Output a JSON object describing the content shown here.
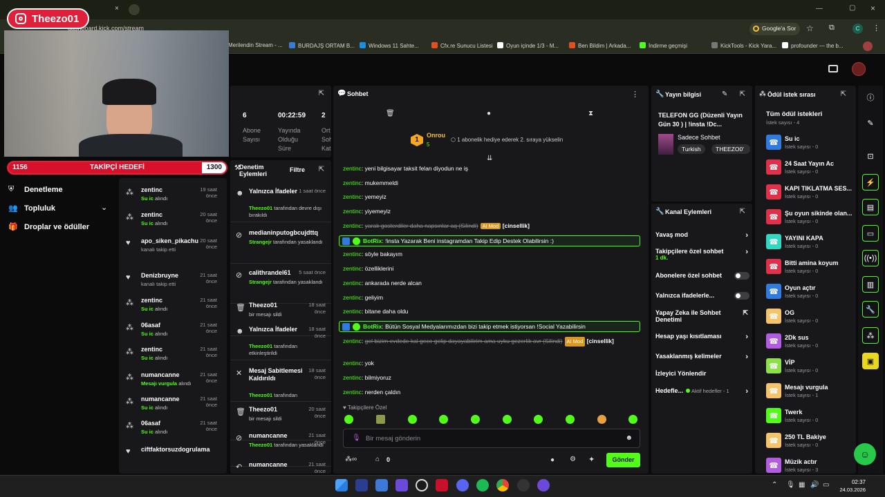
{
  "browser": {
    "url": "dashboard.kick.com/stream",
    "google_search": "Google'a Sor",
    "profile": "C",
    "bookmarks": [
      {
        "label": "Merilendin Stream - ...",
        "color": "#e04040"
      },
      {
        "label": "BURDAJŞ ORTAM B...",
        "color": "#3a7bd5"
      },
      {
        "label": "Windows 11 Sahte...",
        "color": "#1a8fe0"
      },
      {
        "label": "Cfx.re Sunucu Listesi",
        "color": "#e05020"
      },
      {
        "label": "Oyun içinde 1/3 - M...",
        "color": "#ffffff"
      },
      {
        "label": "Ben Bildim | Arkada...",
        "color": "#e05020"
      },
      {
        "label": "İndirme geçmişi",
        "color": "#53fc18"
      },
      {
        "label": "KickTools - Kick Yara...",
        "color": "#777777"
      },
      {
        "label": "profounder — the b...",
        "color": "#ffffff"
      }
    ]
  },
  "overlay": {
    "instagram_name": "Theezo01",
    "goal_current": "1156",
    "goal_label": "TAKİPÇİ HEDEFİ",
    "goal_target": "1300",
    "goal_progress": 0.889
  },
  "left_nav": {
    "items": [
      {
        "label": "Denetleme",
        "icon": "shield-icon"
      },
      {
        "label": "Topluluk",
        "icon": "users-icon"
      },
      {
        "label": "Droplar ve ödüller",
        "icon": "gift-icon"
      }
    ]
  },
  "stats": {
    "items": [
      {
        "value": "6",
        "label": "Abone Sayısı"
      },
      {
        "value": "00:22:59",
        "label": "Yayında Olduğu Süre"
      },
      {
        "value": "2",
        "label": "Ort. Sohbet Katılımcısı"
      }
    ],
    "label_lines": [
      [
        "Abone",
        "Sayısı"
      ],
      [
        "Yayında",
        "Olduğu",
        "Süre"
      ],
      [
        "Ort",
        "Soh",
        "Kat"
      ]
    ]
  },
  "activity": {
    "events": [
      {
        "name": "zentinc",
        "time": "19 saat önce",
        "sub": "Su ic alındı",
        "icon": "cheer-icon"
      },
      {
        "name": "zentinc",
        "time": "20 saat önce",
        "sub": "Su ic alındı",
        "icon": "cheer-icon"
      },
      {
        "name": "apo_siken_pikachu",
        "time": "20 saat önce",
        "sub": "kanalı takip etti",
        "icon": "heart-icon"
      },
      {
        "name": "Denizbruyne",
        "time": "21 saat önce",
        "sub": "kanalı takip etti",
        "icon": "heart-icon"
      },
      {
        "name": "zentinc",
        "time": "21 saat önce",
        "sub": "Su ic alındı",
        "icon": "cheer-icon"
      },
      {
        "name": "06asaf",
        "time": "21 saat önce",
        "sub": "Su ic alındı",
        "icon": "cheer-icon"
      },
      {
        "name": "zentinc",
        "time": "21 saat önce",
        "sub": "Su ic alındı",
        "icon": "cheer-icon"
      },
      {
        "name": "numancanne",
        "time": "21 saat önce",
        "sub": "Mesajı vurgula alındı",
        "icon": "cheer-icon"
      },
      {
        "name": "numancanne",
        "time": "21 saat önce",
        "sub": "Su ic alındı",
        "icon": "cheer-icon"
      },
      {
        "name": "06asaf",
        "time": "21 saat önce",
        "sub": "Su ic alındı",
        "icon": "cheer-icon"
      },
      {
        "name": "ciftfaktorsuzdogrulama",
        "time": "",
        "sub": "",
        "icon": "heart-icon"
      }
    ]
  },
  "moderation": {
    "title": "Denetim Eylemleri",
    "filter": "Filtre",
    "events": [
      {
        "name": "Yalnızca İfadeler",
        "time": "1 saat önce",
        "actor": "Theezo01",
        "sub": "tarafından devre dışı bırakıldı",
        "icon": "smile-icon"
      },
      {
        "name": "medianinputogbcujdttq",
        "time": "",
        "actor": "Strangejr",
        "sub": "tarafından yasaklandı",
        "icon": "ban-icon"
      },
      {
        "name": "calithrandel61",
        "time": "5 saat önce",
        "actor": "Strangejr",
        "sub": "tarafından yasaklandı",
        "icon": "ban-icon"
      },
      {
        "name": "Theezo01",
        "time": "18 saat önce",
        "actor": "",
        "sub": "bir mesajı sildi",
        "icon": "trash-icon"
      },
      {
        "name": "Yalnızca İfadeler",
        "time": "18 saat önce",
        "actor": "Theezo01",
        "sub": "tarafından etkinleştirildi",
        "icon": "smile-icon"
      },
      {
        "name": "Mesaj Sabitlemesi Kaldırıldı",
        "time": "18 saat önce",
        "actor": "Theezo01",
        "sub": "tarafından",
        "icon": "unpin-icon"
      },
      {
        "name": "Theezo01",
        "time": "20 saat önce",
        "actor": "",
        "sub": "bir mesajı sildi",
        "icon": "trash-icon"
      },
      {
        "name": "numancanne",
        "time": "21 saat önce",
        "actor": "Theezo01",
        "sub": "tarafından yasaklandı",
        "icon": "ban-icon"
      },
      {
        "name": "numancanne",
        "time": "21 saat önce",
        "actor": "",
        "sub": "",
        "icon": "undo-icon"
      }
    ]
  },
  "chat": {
    "title": "Sohbet",
    "gifter_name": "Onrou",
    "gifter_count": "5",
    "gifter_rank": "1",
    "gift_prompt": "1 abonelik hediye ederek 2. sıraya yükselin",
    "messages": [
      {
        "user": "zentinc",
        "text": "yeni bilgisayar taksit felan diyodun ne iş"
      },
      {
        "user": "zentinc",
        "text": "mukemmeldi"
      },
      {
        "user": "zentinc",
        "text": "yemeyiz"
      },
      {
        "user": "zentinc",
        "text": "yiyemeyiz"
      },
      {
        "user": "zentinc",
        "text": "yarak gosterdiler daha napsınlar aq (Silindi)",
        "deleted": true,
        "tag": "AI Mod",
        "reason": "[cinsellik]"
      },
      {
        "user": "BotRix",
        "text": "!insta Yazarak Beni instagramdan Takip Edip Destek Olabilirsin :)",
        "bot": true
      },
      {
        "user": "zentinc",
        "text": "söyle bakayım"
      },
      {
        "user": "zentinc",
        "text": "özelliklerini"
      },
      {
        "user": "zentinc",
        "text": "ankarada nerde alcan"
      },
      {
        "user": "zentinc",
        "text": "geliyim"
      },
      {
        "user": "zentinc",
        "text": "bitane daha oldu"
      },
      {
        "user": "BotRix",
        "text": "Bütün Sosyal Medyalarımızdan bizi takip etmek istiyorsan !Social Yazabilirsin",
        "bot": true
      },
      {
        "user": "zentinc",
        "text": "gel bizim evdede kal gece gelip dayayabilirim ama uyku gezerlik avr (Silindi)",
        "deleted": true,
        "tag": "AI Mod",
        "reason": "[cinsellik]"
      },
      {
        "user": "zentinc",
        "text": "yok"
      },
      {
        "user": "zentinc",
        "text": "bilmiyoruz"
      },
      {
        "user": "zentinc",
        "text": "nerden çaldın"
      }
    ],
    "followers_only": "Takipçilere Özel",
    "input_placeholder": "Bir mesaj gönderin",
    "points": "0",
    "send": "Gönder"
  },
  "stream_info": {
    "title": "Yayın bilgisi",
    "stream_title": "TELEFON GG (Düzenli Yayın Gün 30 ) | !insta !Dc...",
    "category": "Sadece Sohbet",
    "tags": [
      "Turkish",
      "THEEZO0'"
    ]
  },
  "channel_actions": {
    "title": "Kanal Eylemleri",
    "rows": [
      {
        "label": "Yavaş mod",
        "control": "arrow"
      },
      {
        "label": "Takipçilere özel sohbet",
        "sub": "1 dk.",
        "control": "arrow"
      },
      {
        "label": "Abonelere özel sohbet",
        "control": "toggle"
      },
      {
        "label": "Yalnızca ifadelerle...",
        "control": "toggle"
      },
      {
        "label": "Yapay Zeka ile Sohbet Denetimi",
        "control": "external"
      },
      {
        "label": "Hesap yaşı kısıtlaması",
        "control": "arrow"
      },
      {
        "label": "Yasaklanmış kelimeler",
        "control": "arrow"
      },
      {
        "label": "İzleyici Yönlendir",
        "control": "none"
      },
      {
        "label": "Hedefle...",
        "sub": "Aktif hedefler - 1",
        "control": "arrow"
      }
    ]
  },
  "rewards": {
    "title": "Ödül istek sırası",
    "all_label": "Tüm ödül istekleri",
    "all_count": "İstek sayısı - 4",
    "items": [
      {
        "title": "Su ic",
        "count": "İstek sayısı - 0",
        "color": "#2f7be0"
      },
      {
        "title": "24 Saat Yayın Ac",
        "count": "İstek sayısı - 0",
        "color": "#e0304a"
      },
      {
        "title": "KAPI TIKLATMA SES...",
        "count": "İstek sayısı - 0",
        "color": "#e0304a"
      },
      {
        "title": "Şu oyun sikinde olan...",
        "count": "İstek sayısı - 0",
        "color": "#e0304a"
      },
      {
        "title": "YAYINI KAPA",
        "count": "İstek sayısı - 0",
        "color": "#2fd8c0"
      },
      {
        "title": "Bitti amina koyum",
        "count": "İstek sayısı - 0",
        "color": "#e0304a"
      },
      {
        "title": "Oyun açtır",
        "count": "İstek sayısı - 0",
        "color": "#2f7be0"
      },
      {
        "title": "OG",
        "count": "İstek sayısı - 0",
        "color": "#f5c36a"
      },
      {
        "title": "2Dk sus",
        "count": "İstek sayısı - 0",
        "color": "#b35ce0"
      },
      {
        "title": "VİP",
        "count": "İstek sayısı - 0",
        "color": "#8ee04a"
      },
      {
        "title": "Mesajı vurgula",
        "count": "İstek sayısı - 1",
        "color": "#f5c36a"
      },
      {
        "title": "Twerk",
        "count": "İstek sayısı - 0",
        "color": "#53fc18"
      },
      {
        "title": "250 TL Bakiye",
        "count": "İstek sayısı - 0",
        "color": "#f5c36a"
      },
      {
        "title": "Müzik actır",
        "count": "İstek sayısı - 3",
        "color": "#b35ce0"
      }
    ]
  },
  "taskbar": {
    "time": "02:37",
    "date": "24.03.2026"
  }
}
